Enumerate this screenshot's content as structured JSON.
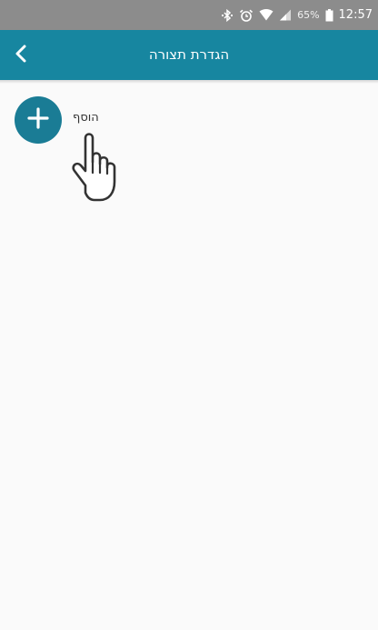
{
  "status_bar": {
    "battery_percent": "65%",
    "time": "12:57",
    "icons": [
      "bluetooth-icon",
      "alarm-icon",
      "wifi-icon",
      "signal-icon",
      "battery-icon"
    ]
  },
  "app_bar": {
    "title": "הגדרת תצורה",
    "back_icon": "chevron-left-icon",
    "color": "#1786a0"
  },
  "content": {
    "add_button_icon": "plus-icon",
    "add_label": "הוסף",
    "accent_color": "#1a7c95",
    "overlay_icon": "hand-pointer-icon"
  }
}
